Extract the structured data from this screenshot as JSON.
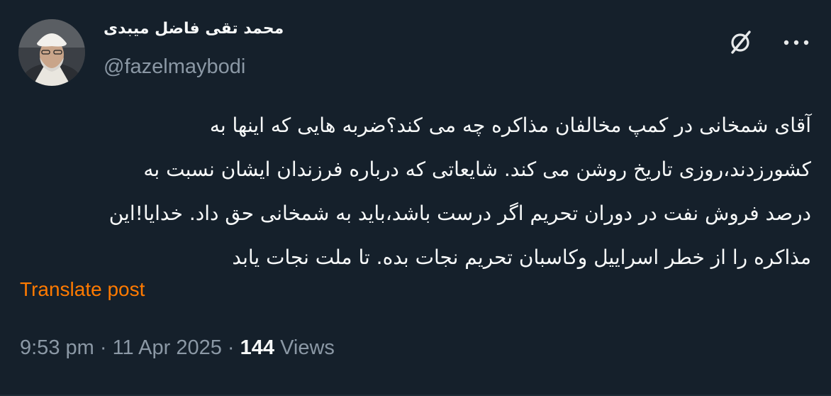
{
  "author": {
    "display_name": "محمد تقی فاضل میبدی",
    "handle": "@fazelmaybodi"
  },
  "post": {
    "lines": [
      "آقای شمخانی در کمپ مخالفان مذاکره چه می کند؟ضربه هایی که اینها به",
      "کشورزدند،روزی تاریخ روشن می کند.  شایعاتی که درباره فرزندان ایشان نسبت به",
      "درصد فروش نفت در دوران تحریم اگر درست باشد،باید به شمخانی حق داد. خدایا!این",
      "مذاکره را از خطر اسراییل وکاسبان تحریم نجات بده. تا ملت نجات یابد"
    ],
    "translate_label": "Translate post"
  },
  "meta": {
    "time": "9:53 pm",
    "separator1": " · ",
    "date": "11 Apr 2025",
    "separator2": " · ",
    "views_count": "144",
    "views_label": " Views"
  },
  "icons": {
    "grok": "grok-icon",
    "more": "more-icon"
  },
  "colors": {
    "background": "#15202b",
    "text": "#f7f9f9",
    "secondary": "#8b98a5",
    "translate": "#ff7a00"
  }
}
